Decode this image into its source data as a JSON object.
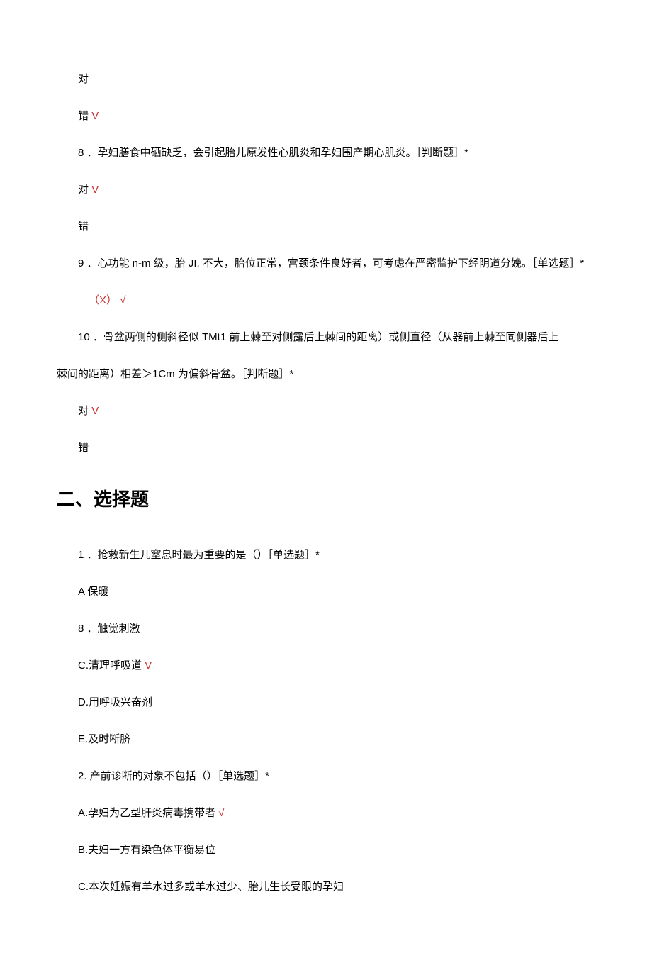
{
  "tf": {
    "q7": {
      "opt_true": "对",
      "opt_false": "错",
      "mark": "V"
    },
    "q8": {
      "text": "8 ．孕妇膳食中硒缺乏，会引起胎儿原发性心肌炎和孕妇围产期心肌炎。［判断题］*",
      "opt_true": "对",
      "mark": "V",
      "opt_false": "错"
    },
    "q9": {
      "text": "9 ．心功能 n-m 级，胎 JI, 不大，胎位正常，宫颈条件良好者，可考虑在严密监护下经阴道分娩。［单选题］*",
      "answer_prefix": "（X）",
      "mark": "√"
    },
    "q10": {
      "text_line1": "10 ．骨盆两侧的侧斜径似 TMt1 前上棘至对侧露后上棘间的距离）或侧直径（从器前上棘至同侧器后上",
      "text_line2": "棘间的距离）相差＞1Cm 为偏斜骨盆。［判断题］*",
      "opt_true": "对",
      "mark": "V",
      "opt_false": "错"
    }
  },
  "section2": {
    "heading": "二、选择题"
  },
  "mc": {
    "q1": {
      "text": "1 ．抢救新生儿窒息时最为重要的是（）［单选题］*",
      "optA": "A 保暖",
      "opt8": "8 ．触觉刺激",
      "optC": "C.清理呼吸道",
      "markC": "V",
      "optD": "D.用呼吸兴奋剂",
      "optE": "E.及时断脐"
    },
    "q2": {
      "text": "2. 产前诊断的对象不包括（）［单选题］*",
      "optA": "A.孕妇为乙型肝炎病毒携带者 ",
      "markA": "√",
      "optB": "B.夫妇一方有染色体平衡易位",
      "optC": "C.本次妊娠有羊水过多或羊水过少、胎儿生长受限的孕妇"
    }
  }
}
